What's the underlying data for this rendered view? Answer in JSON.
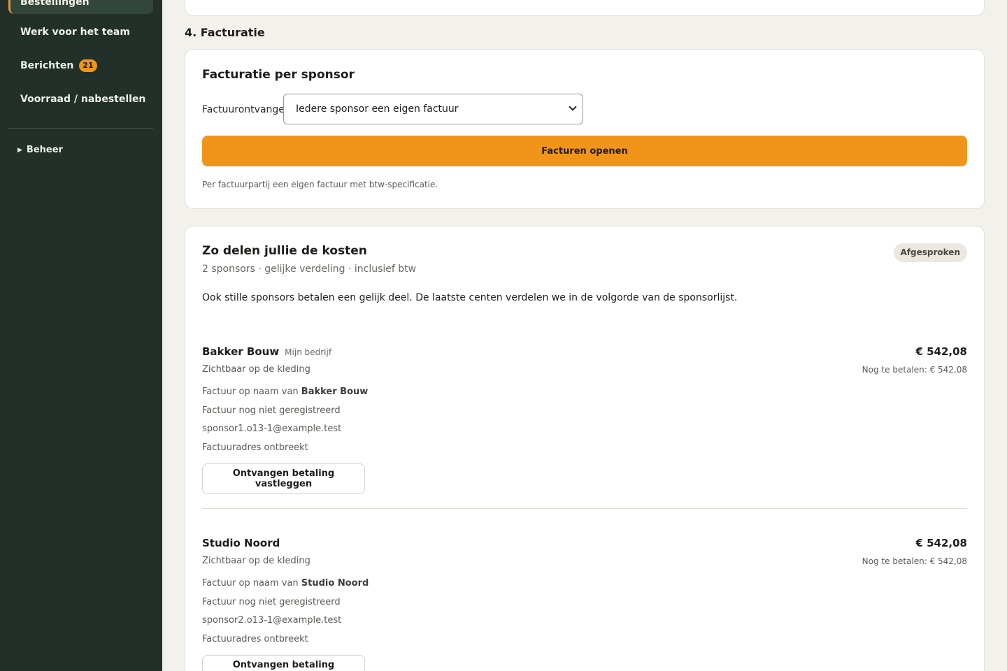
{
  "sidebar": {
    "active_item": "Bestellingen",
    "items": [
      {
        "label": "Werk voor het team"
      },
      {
        "label": "Berichten",
        "badge": "21"
      },
      {
        "label": "Voorraad / nabestellen"
      }
    ],
    "beheer": {
      "icon": "triangle-right-icon",
      "label": "Beheer"
    }
  },
  "section": {
    "title": "4. Facturatie"
  },
  "billing": {
    "title": "Facturatie per sponsor",
    "recipient_label": "Factuurontvanger",
    "recipient_selected": "Iedere sponsor een eigen factuur",
    "open_button": "Facturen openen",
    "hint": "Per factuurpartij een eigen factuur met btw-specificatie."
  },
  "costs": {
    "title": "Zo delen jullie de kosten",
    "status": "Afgesproken",
    "subtitle": "2 sponsors · gelijke verdeling · inclusief btw",
    "intro": "Ook stille sponsors betalen een gelijk deel. De laatste centen verdelen we in de volgorde van de sponsorlijst.",
    "sponsors": [
      {
        "name": "Bakker Bouw",
        "tag": "Mijn bedrijf",
        "visibility": "Zichtbaar op de kleding",
        "invoice_name_prefix": "Factuur op naam van ",
        "invoice_name": "Bakker Bouw",
        "invoice_status": "Factuur nog niet geregistreerd",
        "email": "sponsor1.o13-1@example.test",
        "address_status": "Factuuradres ontbreekt",
        "amount": "€ 542,08",
        "due": "Nog te betalen: € 542,08",
        "action": "Ontvangen betaling vastleggen"
      },
      {
        "name": "Studio Noord",
        "tag": "",
        "visibility": "Zichtbaar op de kleding",
        "invoice_name_prefix": "Factuur op naam van ",
        "invoice_name": "Studio Noord",
        "invoice_status": "Factuur nog niet geregistreerd",
        "email": "sponsor2.o13-1@example.test",
        "address_status": "Factuuradres ontbreekt",
        "amount": "€ 542,08",
        "due": "Nog te betalen: € 542,08",
        "action": "Ontvangen betaling vastleggen"
      }
    ]
  },
  "colors": {
    "sidebar_bg": "#223029",
    "accent": "#f0951a",
    "page_bg": "#f3f1ec"
  }
}
